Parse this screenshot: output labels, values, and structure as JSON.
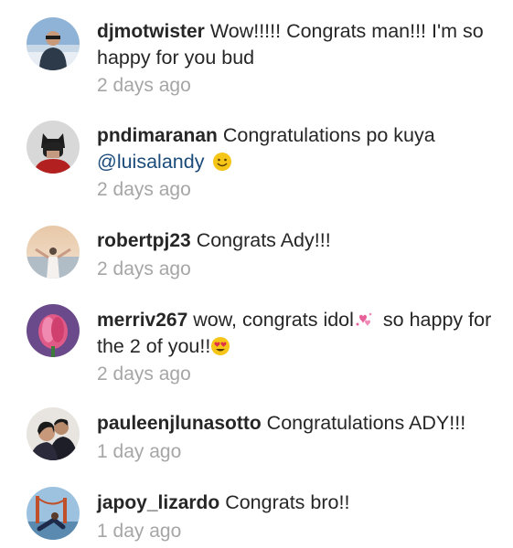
{
  "comments": [
    {
      "username": "djmotwister",
      "text": "Wow!!!!! Congrats man!!! I'm so happy for you bud",
      "time": "2 days ago"
    },
    {
      "username": "pndimaranan",
      "text": "Congratulations po kuya",
      "mention": "@luisalandy",
      "emoji": "smiling-face-emoji",
      "time": "2 days ago"
    },
    {
      "username": "robertpj23",
      "text": "Congrats Ady!!!",
      "time": "2 days ago"
    },
    {
      "username": "merriv267",
      "text_a": "wow, congrats idol",
      "emoji_a": "hearts-emoji",
      "text_b": "so happy for the 2 of you!!",
      "emoji_b": "heart-eyes-emoji",
      "time": "2 days ago"
    },
    {
      "username": "pauleenjlunasotto",
      "text": "Congratulations ADY!!!",
      "time": "1 day ago"
    },
    {
      "username": "japoy_lizardo",
      "text": "Congrats bro!!",
      "time": "1 day ago"
    }
  ],
  "colors": {
    "username": "#262626",
    "text": "#262626",
    "mention": "#1b4b7a",
    "timestamp": "#a6a6a6",
    "background": "#ffffff"
  }
}
